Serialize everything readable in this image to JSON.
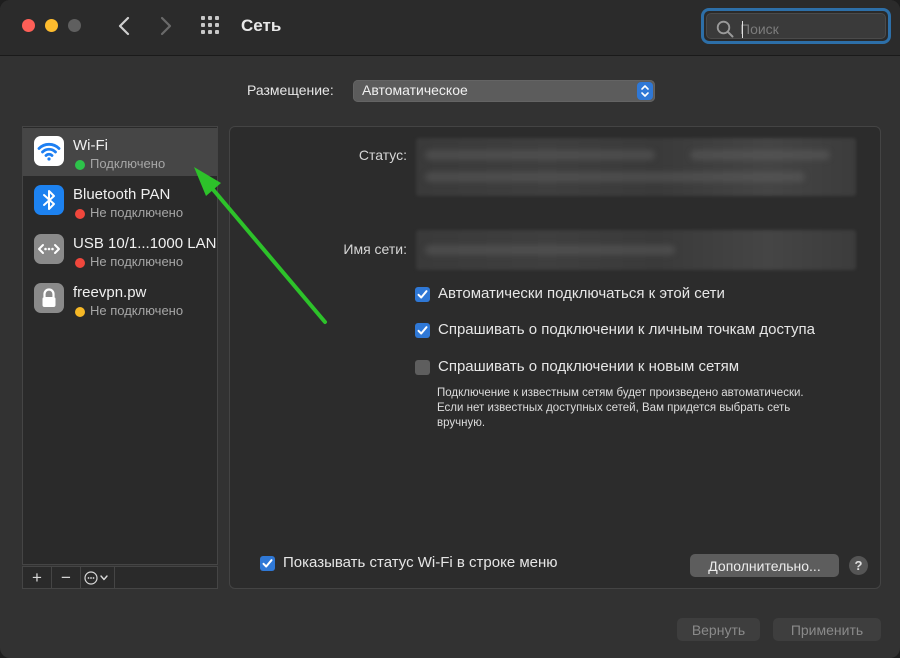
{
  "window": {
    "title": "Сеть"
  },
  "search": {
    "placeholder": "Поиск"
  },
  "location": {
    "label": "Размещение:",
    "value": "Автоматическое"
  },
  "services": [
    {
      "name": "Wi-Fi",
      "status": "Подключено",
      "status_color": "#2dc24a",
      "icon": "wifi-icon",
      "icon_color": "#ffffff",
      "selected": true
    },
    {
      "name": "Bluetooth PAN",
      "status": "Не подключено",
      "status_color": "#f0473c",
      "icon": "bluetooth-icon",
      "icon_color": "#1d82f0"
    },
    {
      "name": "USB 10/1...1000 LAN",
      "status": "Не подключено",
      "status_color": "#f0473c",
      "icon": "ethernet-icon",
      "icon_color": "#8a8a8a"
    },
    {
      "name": "freevpn.pw",
      "status": "Не подключено",
      "status_color": "#f6b826",
      "icon": "lock-icon",
      "icon_color": "#8a8a8a"
    }
  ],
  "sidebar_toolbar": {
    "add": "+",
    "remove": "−",
    "more": "⋯"
  },
  "detail": {
    "status_label": "Статус:",
    "network_name_label": "Имя сети:",
    "options": [
      {
        "label": "Автоматически подключаться к этой сети",
        "checked": true
      },
      {
        "label": "Спрашивать о подключении к личным точкам доступа",
        "checked": true
      },
      {
        "label": "Спрашивать о подключении к новым сетям",
        "checked": false
      }
    ],
    "note": "Подключение к известным сетям будет произведено автоматически. Если нет известных доступных сетей, Вам придется выбрать сеть вручную.",
    "show_wifi_status": {
      "label": "Показывать статус Wi-Fi в строке меню",
      "checked": true
    },
    "advanced_button": "Дополнительно...",
    "help_button": "?"
  },
  "footer": {
    "revert_button": "Вернуть",
    "apply_button": "Применить"
  },
  "colors": {
    "accent": "#2f78d6",
    "annotation_arrow": "#2dc22a"
  }
}
